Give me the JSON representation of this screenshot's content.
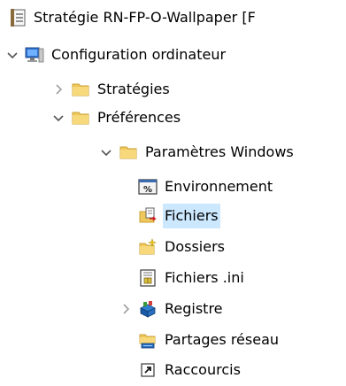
{
  "tree": {
    "root": {
      "label": "Stratégie RN-FP-O-Wallpaper [F",
      "icon": "policy-document-icon"
    },
    "computer_config": {
      "label": "Configuration ordinateur",
      "icon": "computer-icon",
      "expanded": true
    },
    "strategies": {
      "label": "Stratégies",
      "icon": "folder-icon",
      "expanded": false
    },
    "preferences": {
      "label": "Préférences",
      "icon": "folder-icon",
      "expanded": true
    },
    "windows_settings": {
      "label": "Paramètres Windows",
      "icon": "folder-icon",
      "expanded": true
    },
    "items": [
      {
        "label": "Environnement",
        "icon": "environment-variable-icon",
        "selected": false
      },
      {
        "label": "Fichiers",
        "icon": "files-icon",
        "selected": true
      },
      {
        "label": "Dossiers",
        "icon": "new-folder-icon",
        "selected": false
      },
      {
        "label": "Fichiers .ini",
        "icon": "ini-file-icon",
        "selected": false
      },
      {
        "label": "Registre",
        "icon": "registry-icon",
        "selected": false,
        "expandable": true
      },
      {
        "label": "Partages réseau",
        "icon": "network-share-icon",
        "selected": false
      },
      {
        "label": "Raccourcis",
        "icon": "shortcut-icon",
        "selected": false
      }
    ]
  },
  "colors": {
    "selection": "#cce8ff",
    "folder": "#f0c85a",
    "chevron": "#555555"
  }
}
